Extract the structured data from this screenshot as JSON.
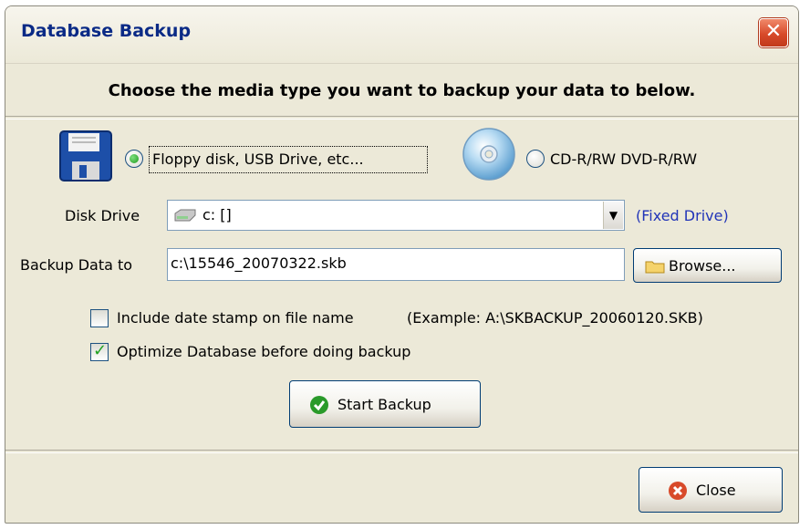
{
  "window": {
    "title": "Database Backup",
    "close_glyph": "✕"
  },
  "instruction": "Choose the media type you want to backup your data to below.",
  "media": {
    "floppy": {
      "label": "Floppy disk, USB Drive, etc...",
      "selected": true,
      "icon": "floppy-disk-icon"
    },
    "cd": {
      "label": "CD-R/RW DVD-R/RW",
      "selected": false,
      "icon": "cd-disc-icon"
    }
  },
  "disk_drive": {
    "label": "Disk Drive",
    "value": "c: []",
    "drive_type": "(Fixed Drive)",
    "icon": "hard-drive-icon"
  },
  "backup_to": {
    "label": "Backup Data to",
    "value": "c:\\15546_20070322.skb",
    "browse_label": "Browse..."
  },
  "options": {
    "datestamp": {
      "label": "Include date stamp on file name",
      "example": "(Example: A:\\SKBACKUP_20060120.SKB)",
      "checked": false
    },
    "optimize": {
      "label": "Optimize Database before doing backup",
      "checked": true
    }
  },
  "buttons": {
    "start_backup": "Start Backup",
    "close": "Close"
  },
  "colors": {
    "title_text": "#0a2a86",
    "dialog_bg": "#ece9d8",
    "link": "#2134b8",
    "check_green": "#21a121",
    "close_red": "#d84a2a"
  }
}
